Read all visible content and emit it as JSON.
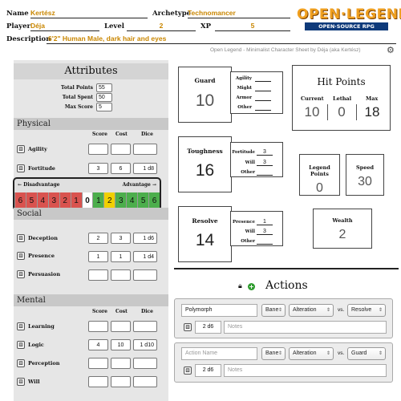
{
  "header": {
    "name_label": "Name",
    "name_value": "Kertész",
    "archetype_label": "Archetype",
    "archetype_value": "Technomancer",
    "player_label": "Player",
    "player_value": "Déja",
    "level_label": "Level",
    "level_value": "2",
    "xp_label": "XP",
    "xp_value": "5",
    "description_label": "Description",
    "description_value": "6'2\" Human Male, dark hair and eyes",
    "logo_main": "OPEN·LEGEND",
    "logo_sub": "OPEN·SOURCE RPG",
    "subtitle": "Open Legend - Minimalist Character Sheet by Déja (aka Kertész)"
  },
  "attributes": {
    "title": "Attributes",
    "total_points_label": "Total Points",
    "total_points": "55",
    "total_spent_label": "Total Spent",
    "total_spent": "50",
    "max_score_label": "Max Score",
    "max_score": "5",
    "col_score": "Score",
    "col_cost": "Cost",
    "col_dice": "Dice",
    "physical": {
      "title": "Physical",
      "rows": [
        {
          "label": "Agility",
          "score": "",
          "cost": "",
          "dice": ""
        },
        {
          "label": "Fortitude",
          "score": "3",
          "cost": "6",
          "dice": "1 d8"
        }
      ]
    },
    "social": {
      "title": "Social",
      "rows": [
        {
          "label": "Deception",
          "score": "2",
          "cost": "3",
          "dice": "1 d6"
        },
        {
          "label": "Presence",
          "score": "1",
          "cost": "1",
          "dice": "1 d4"
        },
        {
          "label": "Persuasion",
          "score": "",
          "cost": "",
          "dice": ""
        }
      ]
    },
    "mental": {
      "title": "Mental",
      "rows": [
        {
          "label": "Learning",
          "score": "",
          "cost": "",
          "dice": ""
        },
        {
          "label": "Logic",
          "score": "4",
          "cost": "10",
          "dice": "1 d10"
        },
        {
          "label": "Perception",
          "score": "",
          "cost": "",
          "dice": ""
        },
        {
          "label": "Will",
          "score": "",
          "cost": "",
          "dice": ""
        }
      ]
    }
  },
  "advantage_bar": {
    "disadvantage_label": "Disadvantage",
    "advantage_label": "Advantage",
    "cells": [
      "6",
      "5",
      "4",
      "3",
      "2",
      "1",
      "0",
      "1",
      "2",
      "3",
      "4",
      "5",
      "6"
    ],
    "colors": [
      "#d9534f",
      "#d9534f",
      "#d9534f",
      "#d9534f",
      "#d9534f",
      "#d9534f",
      "#ffffff",
      "#4cae4c",
      "#f0d000",
      "#4cae4c",
      "#4cae4c",
      "#4cae4c",
      "#4cae4c"
    ]
  },
  "defenses": {
    "guard": {
      "title": "Guard",
      "value": "10",
      "subs": [
        {
          "label": "Agility",
          "value": ""
        },
        {
          "label": "Might",
          "value": ""
        },
        {
          "label": "Armor",
          "value": ""
        },
        {
          "label": "Other",
          "value": ""
        }
      ]
    },
    "toughness": {
      "title": "Toughness",
      "value": "16",
      "subs": [
        {
          "label": "Fortitude",
          "value": "3"
        },
        {
          "label": "Will",
          "value": "3"
        },
        {
          "label": "Other",
          "value": ""
        }
      ]
    },
    "resolve": {
      "title": "Resolve",
      "value": "14",
      "subs": [
        {
          "label": "Presence",
          "value": "1"
        },
        {
          "label": "Will",
          "value": "3"
        },
        {
          "label": "Other",
          "value": ""
        }
      ]
    }
  },
  "hit_points": {
    "title": "Hit Points",
    "current_label": "Current",
    "current": "10",
    "lethal_label": "Lethal",
    "lethal": "0",
    "max_label": "Max",
    "max": "18"
  },
  "legend_points": {
    "label": "Legend Points",
    "value": "0"
  },
  "speed": {
    "label": "Speed",
    "value": "30"
  },
  "wealth": {
    "label": "Wealth",
    "value": "2"
  },
  "actions": {
    "title": "Actions",
    "vs_label": "vs.",
    "items": [
      {
        "name": "Polymorph",
        "name_placeholder": "Action Name",
        "bane": "Bane",
        "attribute": "Alteration",
        "target": "Resolve",
        "dice": "2 d6",
        "notes_placeholder": "Notes"
      },
      {
        "name": "",
        "name_placeholder": "Action Name",
        "bane": "Bane",
        "attribute": "Alteration",
        "target": "Guard",
        "dice": "2 d6",
        "notes_placeholder": "Notes"
      }
    ]
  },
  "icons": {
    "die": "die-icon",
    "gear": "gear-icon",
    "lock": "lock-icon",
    "add": "add-icon"
  }
}
